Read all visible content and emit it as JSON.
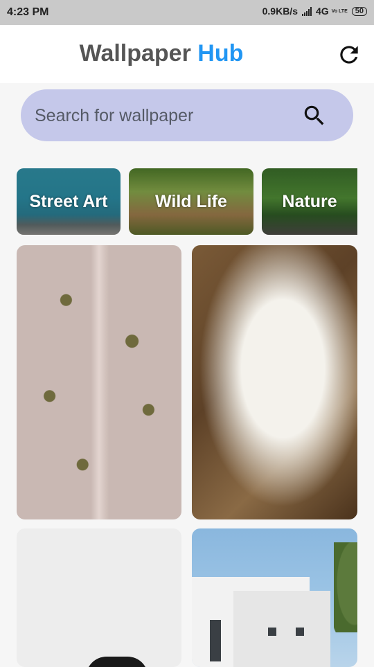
{
  "status_bar": {
    "time": "4:23 PM",
    "speed": "0.9KB/s",
    "network": "4G",
    "volte": "Vo LTE",
    "battery": "50"
  },
  "app_bar": {
    "title_part1": "Wallpaper",
    "title_part2": "Hub",
    "refresh_icon": "refresh-icon",
    "accent_color": "#2196f3"
  },
  "search": {
    "placeholder": "Search for wallpaper",
    "icon": "search-icon",
    "background": "#c5c8ea"
  },
  "categories": [
    {
      "label": "Street Art"
    },
    {
      "label": "Wild Life"
    },
    {
      "label": "Nature"
    }
  ],
  "wallpapers": [
    {
      "id": "aerial-desert"
    },
    {
      "id": "man-in-white"
    },
    {
      "id": "white-minimal"
    },
    {
      "id": "white-buildings"
    }
  ]
}
